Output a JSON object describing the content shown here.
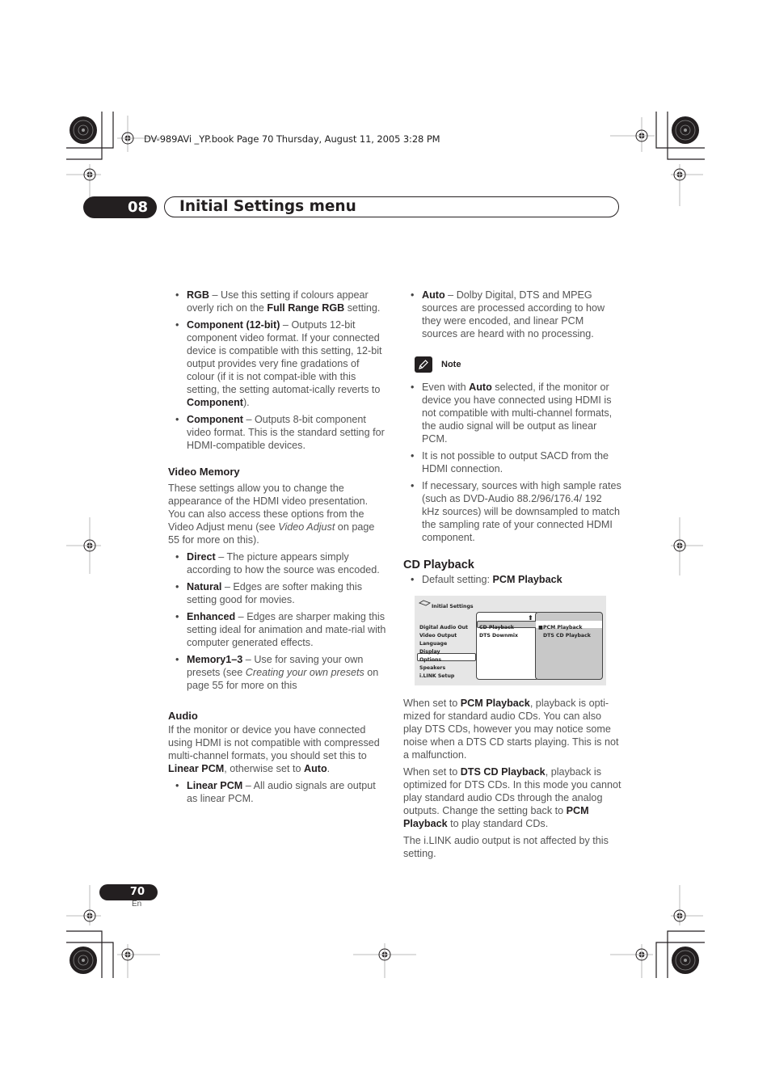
{
  "print_header": "DV-989AVi _YP.book  Page 70  Thursday, August 11, 2005  3:28 PM",
  "chapter": {
    "number": "08",
    "title": "Initial Settings menu"
  },
  "left_column": {
    "bullets_top": [
      {
        "term": "RGB",
        "text": " – Use this setting if colours appear overly rich on the ",
        "term2": "Full Range RGB",
        "text2": " setting."
      },
      {
        "term": "Component (12-bit)",
        "text": " – Outputs 12-bit component video format. If your connected device is compatible with this setting, 12-bit output provides very fine gradations of colour (if it is not compat-ible with this setting, the setting automat-ically reverts to ",
        "term2": "Component",
        "text2": ")."
      },
      {
        "term": "Component",
        "text": " – Outputs 8-bit component video format. This is the standard setting for HDMI-compatible devices."
      }
    ],
    "video_memory": {
      "heading": "Video Memory",
      "intro_a": "These settings allow you to change the appearance of the HDMI video presentation. You can also access these options from the Video Adjust menu (see ",
      "intro_italic": "Video Adjust",
      "intro_b": " on page 55 for more on this).",
      "bullets": [
        {
          "term": "Direct",
          "text": " – The picture appears simply according to how the source was encoded."
        },
        {
          "term": "Natural",
          "text": " – Edges are softer making this setting good for movies."
        },
        {
          "term": "Enhanced",
          "text": " – Edges are sharper making this setting ideal for animation and mate-rial with computer generated effects."
        },
        {
          "term": "Memory1–3",
          "text": " – Use for saving your own presets (see ",
          "italic": "Creating your own presets",
          "text2": " on page 55 for more on this"
        }
      ]
    },
    "audio": {
      "heading": "Audio",
      "intro_a": "If the monitor or device you have connected using HDMI is not compatible with compressed multi-channel formats, you should set this to ",
      "term1": "Linear PCM",
      "intro_b": ", otherwise set to ",
      "term2": "Auto",
      "intro_c": ".",
      "bullets": [
        {
          "term": "Linear PCM",
          "text": " – All audio signals are output as linear PCM."
        }
      ]
    }
  },
  "right_column": {
    "auto_bullet": {
      "term": "Auto",
      "text": " – Dolby Digital, DTS and MPEG sources are processed according to how they were encoded, and linear PCM sources are heard with no processing."
    },
    "note": {
      "label": "Note",
      "bullets": [
        {
          "text_a": "Even with ",
          "term": "Auto",
          "text_b": " selected, if the monitor or device you have connected using HDMI is not compatible with multi-channel formats, the audio signal will be output as linear PCM."
        },
        {
          "text_a": "It is not possible to output SACD from the HDMI connection."
        },
        {
          "text_a": "If necessary, sources with high sample rates (such as DVD-Audio 88.2/96/176.4/ 192 kHz sources) will be downsampled to match the sampling rate of your connected HDMI component."
        }
      ]
    },
    "cd_playback": {
      "heading": "CD Playback",
      "default_label": "Default setting: ",
      "default_value": "PCM Playback",
      "osd": {
        "title": "Initial Settings",
        "menu": [
          "Digital Audio Out",
          "Video Output",
          "Language",
          "Display",
          "Options",
          "Speakers",
          "i.LINK Setup"
        ],
        "selected_menu": "Options",
        "submenu": [
          "CD Playback",
          "DTS Downmix"
        ],
        "selected_submenu": "CD Playback",
        "options": [
          "PCM Playback",
          "DTS CD Playback"
        ],
        "selected_option": "PCM Playback"
      },
      "para1_a": "When set to ",
      "para1_term": "PCM Playback",
      "para1_b": ", playback is opti-mized for standard audio CDs. You can also play DTS CDs, however you may notice some noise when a DTS CD starts playing. This is not a malfunction.",
      "para2_a": "When set to ",
      "para2_term": "DTS CD Playback",
      "para2_b": ", playback is optimized for DTS CDs. In this mode you cannot play standard audio CDs through the analog outputs. Change the setting back to ",
      "para2_term2": "PCM Playback",
      "para2_c": " to play standard CDs.",
      "para3": "The i.LINK audio output is not affected by this setting."
    }
  },
  "footer": {
    "page_number": "70",
    "language": "En"
  }
}
